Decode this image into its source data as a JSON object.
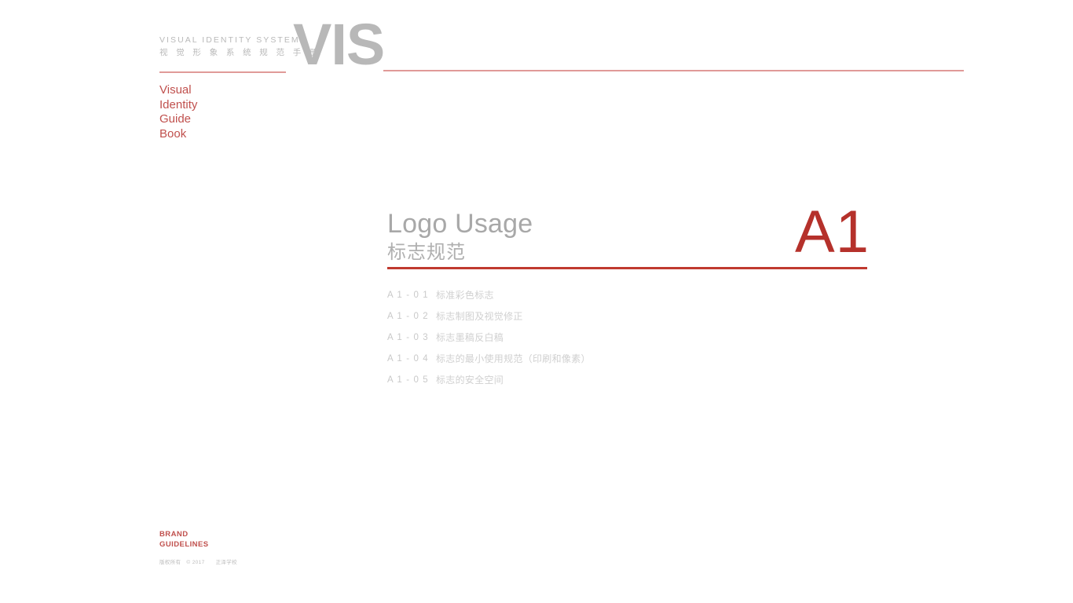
{
  "document": {
    "title": "VIS Visual Identity Guide Book",
    "accent_red": "#c0392f",
    "light_red": "#e09a98",
    "brand_red": "#c0504d",
    "gray": "#b8b8b8",
    "toc_gray": "#d0d0d0"
  },
  "masthead": {
    "english": "VISUAL  IDENTITY  SYSTEM",
    "chinese": "视 觉 形 象 系 统 规 范 手 册",
    "logotype": "VIS"
  },
  "brandwords": {
    "line1": "Visual",
    "line2": "Identity",
    "line3": "Guide",
    "line4": "Book"
  },
  "section": {
    "title_en": "Logo Usage",
    "title_cn": "标志规范",
    "code": "A1"
  },
  "toc": {
    "items": [
      {
        "code": "A 1 - 0 1",
        "label": "标准彩色标志"
      },
      {
        "code": "A 1 - 0 2",
        "label": "标志制图及视觉修正"
      },
      {
        "code": "A 1 - 0 3",
        "label": "标志墨稿反白稿"
      },
      {
        "code": "A 1 - 0 4",
        "label": "标志的最小使用规范（印刷和像素）"
      },
      {
        "code": "A 1 - 0 5",
        "label": "标志的安全空间"
      }
    ]
  },
  "footer": {
    "brand_line1": "BRAND",
    "brand_line2": "GUIDELINES",
    "copyright_cn": "版权所有",
    "copyright_mark": "© 2017",
    "copyright_owner": "正泽学校"
  }
}
